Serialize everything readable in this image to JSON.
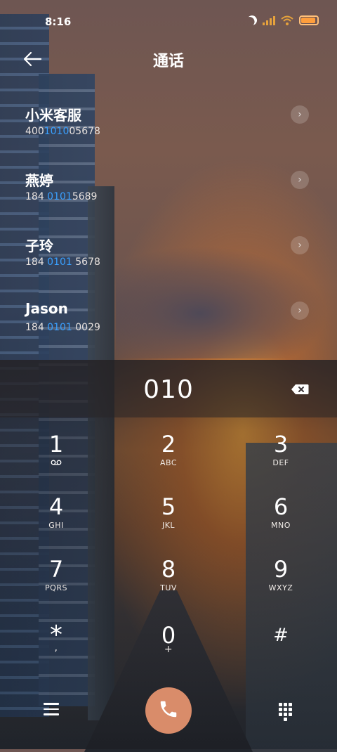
{
  "status_bar": {
    "time": "8:16",
    "battery_level": 0.85,
    "icons": [
      "moon-icon",
      "signal-icon",
      "wifi-icon",
      "battery-icon"
    ]
  },
  "header": {
    "title": "通话",
    "back_icon": "back-arrow-icon"
  },
  "contacts": [
    {
      "name": "小米客服",
      "num_pre": "400",
      "num_hl": "1010",
      "num_post": "05678"
    },
    {
      "name": "燕婷",
      "num_pre": "184 ",
      "num_hl": "0101",
      "num_post": "5689"
    },
    {
      "name": "子玲",
      "num_pre": "184 ",
      "num_hl": "0101",
      "num_post": " 5678"
    },
    {
      "name": "Jason",
      "num_pre": "184 ",
      "num_hl": "0101",
      "num_post": " 0029"
    }
  ],
  "dial_entry": {
    "digits": "010"
  },
  "keypad": [
    {
      "digit": "1",
      "letters": "ᴑᴑ"
    },
    {
      "digit": "2",
      "letters": "ABC"
    },
    {
      "digit": "3",
      "letters": "DEF"
    },
    {
      "digit": "4",
      "letters": "GHI"
    },
    {
      "digit": "5",
      "letters": "JKL"
    },
    {
      "digit": "6",
      "letters": "MNO"
    },
    {
      "digit": "7",
      "letters": "PQRS"
    },
    {
      "digit": "8",
      "letters": "TUV"
    },
    {
      "digit": "9",
      "letters": "WXYZ"
    },
    {
      "digit": "*",
      "letters": ","
    },
    {
      "digit": "0",
      "letters": "+"
    },
    {
      "digit": "#",
      "letters": ""
    }
  ],
  "colors": {
    "highlight": "#3aa0ff",
    "call_button": "#d98c6a",
    "battery": "#ff9e3c"
  }
}
